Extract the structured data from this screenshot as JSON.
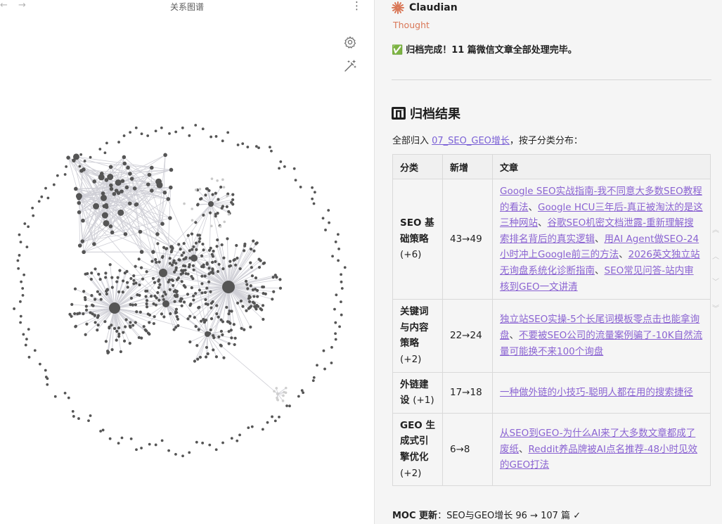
{
  "graph": {
    "title": "关系图谱",
    "nav_back": "←",
    "nav_forward": "→",
    "more_glyph": "⋮",
    "settings_icon": "gear-icon",
    "wand_icon": "magic-wand-icon",
    "node_color": "#555555",
    "edge_color": "#cfcfd6"
  },
  "chat": {
    "app_title": "Claudian",
    "app_icon": "claudian-burst-icon",
    "accent_color": "#d97757",
    "thought_label": "Thought",
    "done_check": "✅",
    "done_message": "归档完成！11 篇微信文章全部处理完毕。",
    "result_heading_icon": "bar-chart-icon",
    "result_heading": "归档结果",
    "intro_prefix": "全部归入 ",
    "intro_link": "07_SEO_GEO增长",
    "intro_suffix": "，按子分类分布：",
    "table": {
      "headers": [
        "分类",
        "新增",
        "文章"
      ],
      "rows": [
        {
          "category": "SEO 基础策略",
          "delta": "(+6)",
          "count": "43→49",
          "articles": [
            "Google SEO实战指南-我不同意大多数SEO教程的看法",
            "Google HCU三年后-真正被淘汰的是这三种网站",
            "谷歌SEO机密文档泄露-重新理解搜索排名背后的真实逻辑",
            "用AI Agent做SEO-24小时冲上Google前三的方法",
            "2026英文独立站无询盘系统化诊断指南",
            "SEO常见问答-站内审核到GEO一文讲清"
          ]
        },
        {
          "category": "关键词与内容策略",
          "delta": "(+2)",
          "count": "22→24",
          "articles": [
            "独立站SEO实操-5个长尾词模板零点击也能拿询盘",
            "不要被SEO公司的流量案例骗了-10K自然流量可能换不来100个询盘"
          ]
        },
        {
          "category": "外链建设",
          "delta": "(+1)",
          "count": "17→18",
          "articles": [
            "一种做外链的小技巧-聪明人都在用的搜索捷径"
          ]
        },
        {
          "category": "GEO 生成式引擎优化",
          "delta": "(+2)",
          "count": "6→8",
          "articles": [
            "从SEO到GEO-为什么AI来了大多数文章都成了废纸",
            "Reddit养品牌被AI点名推荐-48小时见效的GEO打法"
          ]
        }
      ],
      "separator": "、"
    },
    "moc_label": "MOC 更新",
    "moc_text": "：SEO与GEO增长 96 → 107 篇 ✓",
    "link_color": "#8a63d2"
  }
}
